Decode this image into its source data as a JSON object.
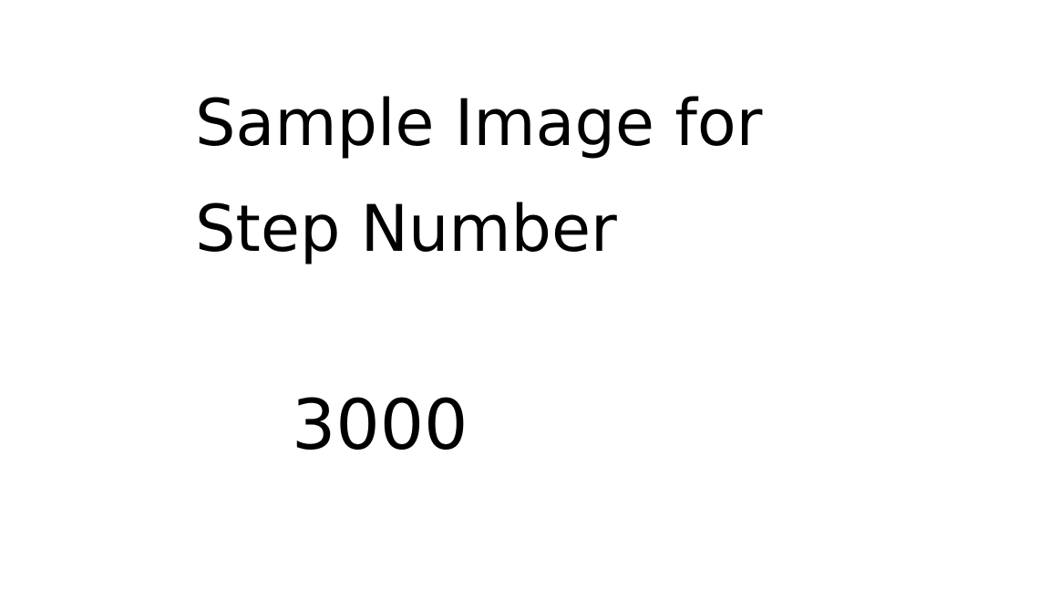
{
  "slide": {
    "title_line_1": "Sample Image for",
    "title_line_2": "Step Number",
    "step_number": "3000"
  },
  "colors": {
    "background": "#ffffff",
    "text": "#000000"
  }
}
